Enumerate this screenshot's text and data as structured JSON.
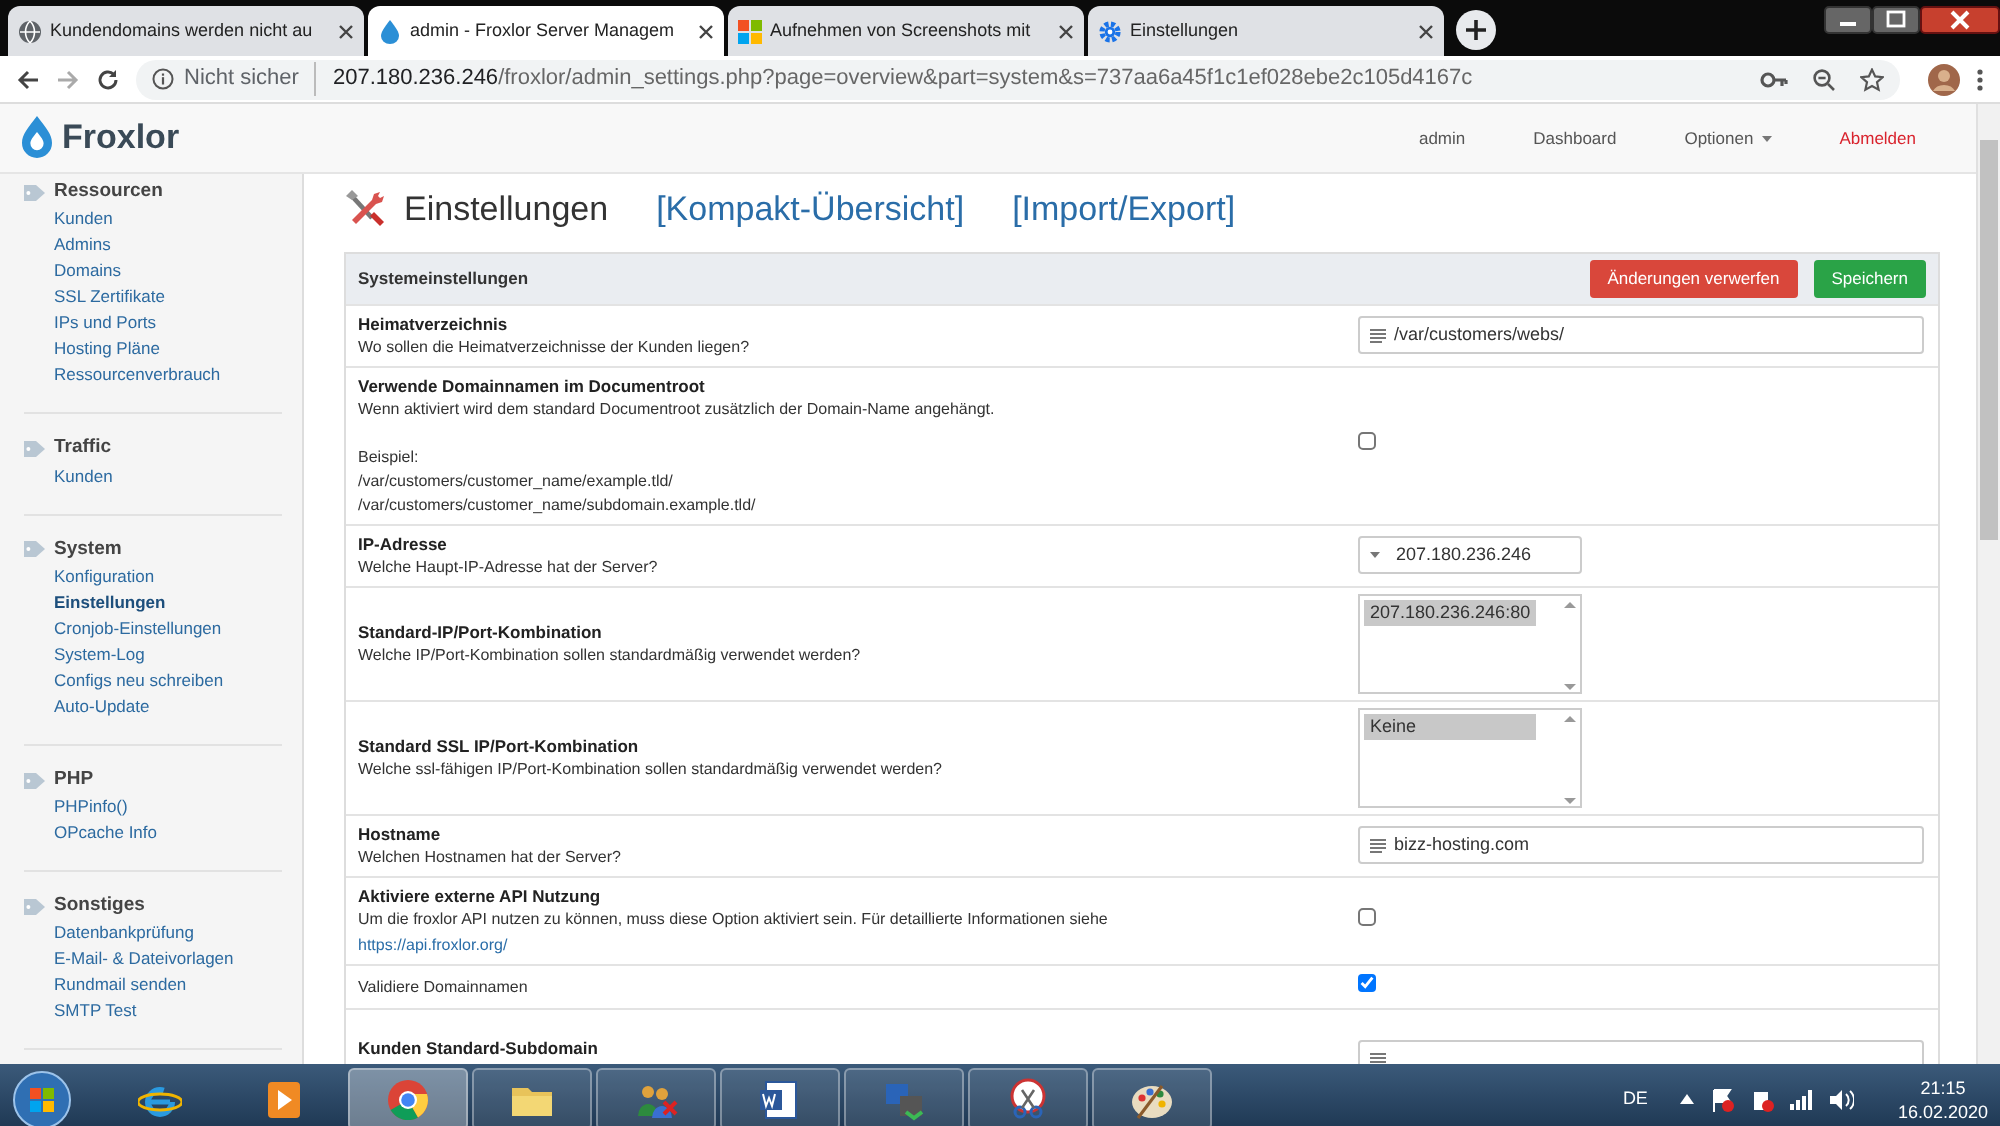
{
  "browser": {
    "tabs": [
      {
        "title": "Kundendomains werden nicht au",
        "selected": false
      },
      {
        "title": "admin - Froxlor Server Managem",
        "selected": true
      },
      {
        "title": "Aufnehmen von Screenshots mit",
        "selected": false
      },
      {
        "title": "Einstellungen",
        "selected": false
      }
    ],
    "address": {
      "security": "Nicht sicher",
      "host": "207.180.236.246",
      "path": "/froxlor/admin_settings.php?page=overview&part=system&s=737aa6a45f1c1ef028ebe2c105d4167c"
    }
  },
  "navbar": {
    "logo": "Froxlor",
    "items": [
      {
        "label": "admin",
        "kind": "user"
      },
      {
        "label": "Dashboard",
        "kind": "link"
      },
      {
        "label": "Optionen",
        "kind": "dropdown"
      },
      {
        "label": "Abmelden",
        "kind": "logout"
      }
    ]
  },
  "sidebar": {
    "groups": [
      {
        "title": "Ressourcen",
        "items": [
          {
            "label": "Kunden",
            "selected": false
          },
          {
            "label": "Admins",
            "selected": false
          },
          {
            "label": "Domains",
            "selected": false
          },
          {
            "label": "SSL Zertifikate",
            "selected": false
          },
          {
            "label": "IPs und Ports",
            "selected": false
          },
          {
            "label": "Hosting Pläne",
            "selected": false
          },
          {
            "label": "Ressourcenverbrauch",
            "selected": false
          }
        ]
      },
      {
        "title": "Traffic",
        "items": [
          {
            "label": "Kunden",
            "selected": false
          }
        ]
      },
      {
        "title": "System",
        "items": [
          {
            "label": "Konfiguration",
            "selected": false
          },
          {
            "label": "Einstellungen",
            "selected": true
          },
          {
            "label": "Cronjob-Einstellungen",
            "selected": false
          },
          {
            "label": "System-Log",
            "selected": false
          },
          {
            "label": "Configs neu schreiben",
            "selected": false
          },
          {
            "label": "Auto-Update",
            "selected": false
          }
        ]
      },
      {
        "title": "PHP",
        "items": [
          {
            "label": "PHPinfo()",
            "selected": false
          },
          {
            "label": "OPcache Info",
            "selected": false
          }
        ]
      },
      {
        "title": "Sonstiges",
        "items": [
          {
            "label": "Datenbankprüfung",
            "selected": false
          },
          {
            "label": "E-Mail- & Dateivorlagen",
            "selected": false
          },
          {
            "label": "Rundmail senden",
            "selected": false
          },
          {
            "label": "SMTP Test",
            "selected": false
          }
        ]
      }
    ]
  },
  "page": {
    "title": "Einstellungen",
    "links": [
      "[Kompakt-Übersicht]",
      "[Import/Export]"
    ]
  },
  "panel": {
    "title": "Systemeinstellungen",
    "buttons": [
      {
        "label": "Änderungen verwerfen",
        "kind": "danger"
      },
      {
        "label": "Speichern",
        "kind": "success"
      }
    ]
  },
  "settings": [
    {
      "kind": "text",
      "title": "Heimatverzeichnis",
      "description": "Wo sollen die Heimatverzeichnisse der Kunden liegen?",
      "value": "/var/customers/webs/"
    },
    {
      "kind": "checkbox",
      "title": "Verwende Domainnamen im Documentroot",
      "description": "Wenn aktiviert wird dem standard Documentroot zusätzlich der Domain-Name angehängt.",
      "notes": [
        "Beispiel:",
        "/var/customers/customer_name/example.tld/",
        "/var/customers/customer_name/subdomain.example.tld/"
      ],
      "checked": false
    },
    {
      "kind": "select",
      "title": "IP-Adresse",
      "description": "Welche Haupt-IP-Adresse hat der Server?",
      "value": "207.180.236.246"
    },
    {
      "kind": "multiselect",
      "title": "Standard-IP/Port-Kombination",
      "description": "Welche IP/Port-Kombination sollen standardmäßig verwendet werden?",
      "options": [
        {
          "label": "207.180.236.246:80",
          "selected": true
        }
      ]
    },
    {
      "kind": "multiselect",
      "title": "Standard SSL IP/Port-Kombination",
      "description": "Welche ssl-fähigen IP/Port-Kombination sollen standardmäßig verwendet werden?",
      "options": [
        {
          "label": "Keine",
          "selected": true
        }
      ]
    },
    {
      "kind": "text",
      "title": "Hostname",
      "description": "Welchen Hostnamen hat der Server?",
      "value": "bizz-hosting.com"
    },
    {
      "kind": "checkbox",
      "title": "Aktiviere externe API Nutzung",
      "description": "Um die froxlor API nutzen zu können, muss diese Option aktiviert sein. Für detaillierte Informationen siehe",
      "link": "https://api.froxlor.org/",
      "checked": false
    },
    {
      "kind": "checkbox",
      "label": "Validiere Domainnamen",
      "checked": true
    },
    {
      "kind": "text",
      "title": "Kunden Standard-Subdomain"
    }
  ],
  "taskbar": {
    "apps": [
      {
        "open": false,
        "selected": false
      },
      {
        "open": false,
        "selected": false
      },
      {
        "open": true,
        "selected": true
      },
      {
        "open": true,
        "selected": false
      },
      {
        "open": true,
        "selected": false
      },
      {
        "open": true,
        "selected": false
      },
      {
        "open": true,
        "selected": false
      },
      {
        "open": true,
        "selected": false
      },
      {
        "open": true,
        "selected": false
      }
    ],
    "language": "DE",
    "time": "21:15",
    "date": "16.02.2020"
  }
}
